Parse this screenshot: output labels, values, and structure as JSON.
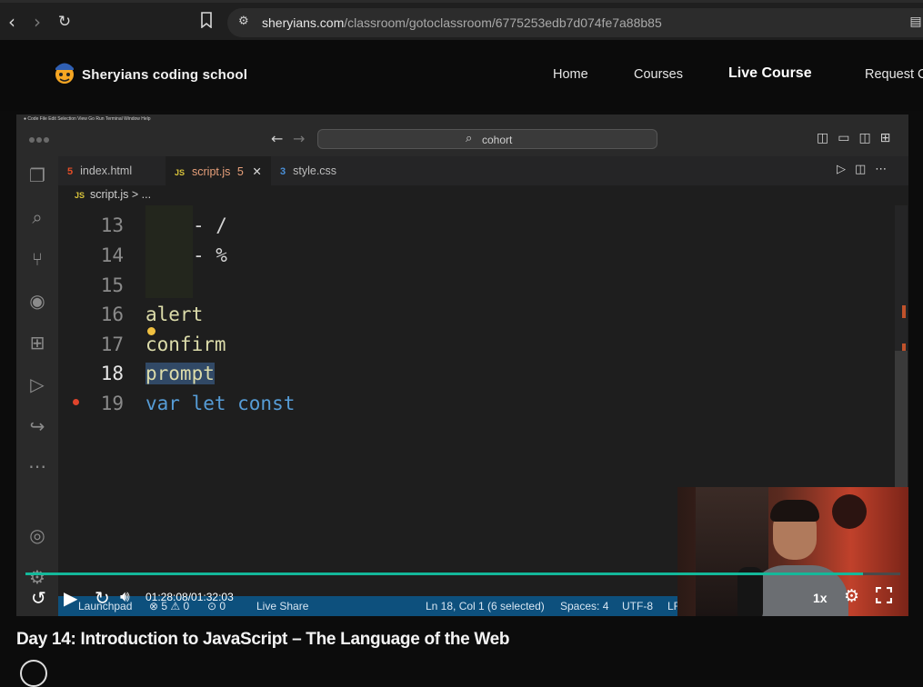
{
  "browser": {
    "url_host": "sheryians.com",
    "url_path": "/classroom/gotoclassroom/6775253edb7d074fe7a88b85"
  },
  "site": {
    "brand": "Sheryians coding school",
    "nav": [
      "Home",
      "Courses",
      "Live Course",
      "Request C"
    ],
    "active_nav": "Live Course"
  },
  "ide": {
    "search": "cohort",
    "tabs": [
      {
        "label": "index.html",
        "type": "HTML"
      },
      {
        "label": "script.js",
        "type": "JS",
        "badge": "5",
        "active": true
      },
      {
        "label": "style.css",
        "type": "CSS"
      }
    ],
    "breadcrumb": "script.js > ...",
    "lines": [
      {
        "num": "13",
        "text": "- /"
      },
      {
        "num": "14",
        "text": "- %"
      },
      {
        "num": "15",
        "text": ""
      },
      {
        "num": "16",
        "text": "alert"
      },
      {
        "num": "17",
        "text": "confirm"
      },
      {
        "num": "18",
        "text": "prompt"
      },
      {
        "num": "19",
        "text": "var let const"
      }
    ],
    "status": {
      "launchpad": "Launchpad",
      "problems": "⊗ 5 ⚠ 0",
      "ports": "⊙ 0",
      "liveshare": "Live Share",
      "position": "Ln 18, Col 1 (6 selected)",
      "spaces": "Spaces: 4",
      "encoding": "UTF-8",
      "eol": "LF"
    }
  },
  "player": {
    "time": "01:28:08/01:32:03",
    "speed": "1x",
    "progress": 0.957
  },
  "video": {
    "title": "Day 14: Introduction to JavaScript – The Language of the Web"
  },
  "colors": {
    "accent": "#14b89a",
    "background": "#0c0c0c"
  }
}
